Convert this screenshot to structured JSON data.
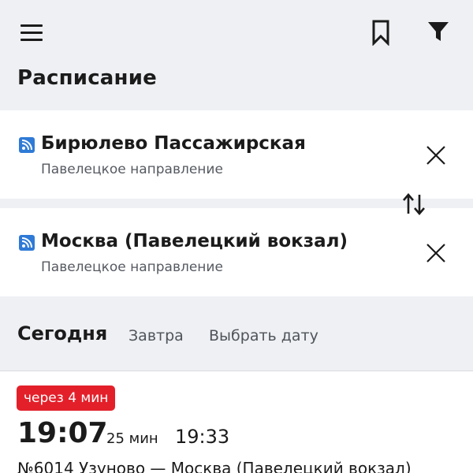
{
  "header": {
    "title": "Расписание",
    "menu_icon": "hamburger-menu-icon",
    "bookmark_icon": "bookmark-icon",
    "filter_icon": "filter-funnel-icon"
  },
  "route_selection": {
    "from": {
      "name": "Бирюлево Пассажирская",
      "direction": "Павелецкое направление",
      "icon": "rss-wifi-icon"
    },
    "to": {
      "name": "Москва (Павелецкий вокзал)",
      "direction": "Павелецкое направление",
      "icon": "rss-wifi-icon"
    },
    "swap_icon": "swap-arrows-icon",
    "clear_icon": "close-x-icon"
  },
  "date_tabs": [
    {
      "label": "Сегодня",
      "selected": true
    },
    {
      "label": "Завтра",
      "selected": false
    },
    {
      "label": "Выбрать дату",
      "selected": false
    }
  ],
  "trains": [
    {
      "badge": "через 4 мин",
      "departure": "19:07",
      "duration": "25 мин",
      "arrival": "19:33",
      "route": "№6014 Узуново — Москва (Павелецкий вокзал)"
    }
  ],
  "colors": {
    "header_bg": "#eef0f3",
    "badge_red": "#e3202a",
    "icon_blue": "#2f7ad6",
    "text_dark": "#1b1b1b",
    "text_muted": "#555a61"
  }
}
